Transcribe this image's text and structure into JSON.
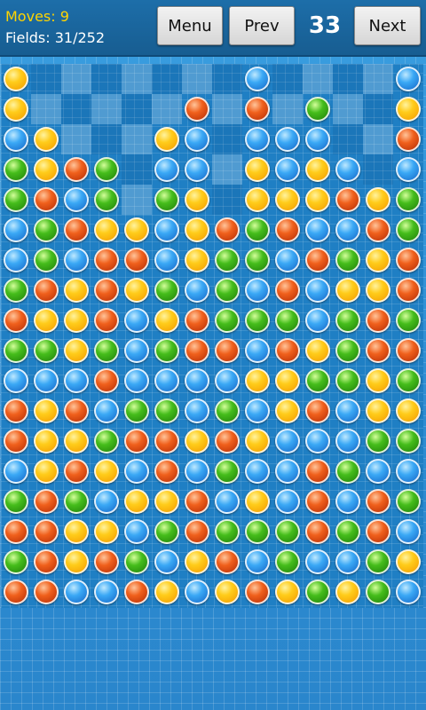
{
  "stats": {
    "moves": "Moves: 9",
    "fields": "Fields: 31/252"
  },
  "toolbar": {
    "menu_label": "Menu",
    "prev_label": "Prev",
    "level": "33",
    "next_label": "Next"
  },
  "colors": {
    "O": "orange",
    "B": "blue",
    "G": "green",
    "R": "red"
  },
  "board": {
    "columns": 14,
    "rows": 18,
    "cleared_cells": 31,
    "balls": [
      [
        "O",
        "",
        "",
        "",
        "",
        "",
        "",
        "",
        "B",
        "",
        "",
        "",
        "",
        "B"
      ],
      [
        "O",
        "",
        "",
        "",
        "",
        "",
        "R",
        "",
        "R",
        "",
        "G",
        "",
        "",
        "O"
      ],
      [
        "B",
        "O",
        "",
        "",
        "",
        "O",
        "B",
        "",
        "B",
        "B",
        "B",
        "",
        "",
        "R"
      ],
      [
        "G",
        "O",
        "R",
        "G",
        "",
        "B",
        "B",
        "",
        "O",
        "B",
        "O",
        "B",
        "",
        "B"
      ],
      [
        "G",
        "R",
        "B",
        "G",
        "",
        "G",
        "O",
        "",
        "O",
        "O",
        "O",
        "R",
        "O",
        "G"
      ],
      [
        "B",
        "G",
        "R",
        "O",
        "O",
        "B",
        "O",
        "R",
        "G",
        "R",
        "B",
        "B",
        "R",
        "G"
      ],
      [
        "B",
        "G",
        "B",
        "R",
        "R",
        "B",
        "O",
        "G",
        "G",
        "B",
        "R",
        "G",
        "O",
        "R"
      ],
      [
        "G",
        "R",
        "O",
        "R",
        "O",
        "G",
        "B",
        "G",
        "B",
        "R",
        "B",
        "O",
        "O",
        "R"
      ],
      [
        "R",
        "O",
        "O",
        "R",
        "B",
        "O",
        "R",
        "G",
        "G",
        "G",
        "B",
        "G",
        "R",
        "G"
      ],
      [
        "G",
        "G",
        "O",
        "G",
        "B",
        "G",
        "R",
        "R",
        "B",
        "R",
        "O",
        "G",
        "R",
        "R"
      ],
      [
        "B",
        "B",
        "B",
        "R",
        "B",
        "B",
        "B",
        "B",
        "O",
        "O",
        "G",
        "G",
        "O",
        "G"
      ],
      [
        "R",
        "O",
        "R",
        "B",
        "G",
        "G",
        "B",
        "G",
        "B",
        "O",
        "R",
        "B",
        "O",
        "O"
      ],
      [
        "R",
        "O",
        "O",
        "G",
        "R",
        "R",
        "O",
        "R",
        "O",
        "B",
        "B",
        "B",
        "G",
        "G"
      ],
      [
        "B",
        "O",
        "R",
        "O",
        "B",
        "R",
        "B",
        "G",
        "B",
        "B",
        "R",
        "G",
        "B",
        "B"
      ],
      [
        "G",
        "R",
        "G",
        "B",
        "O",
        "O",
        "R",
        "B",
        "O",
        "B",
        "R",
        "B",
        "R",
        "G"
      ],
      [
        "R",
        "R",
        "O",
        "O",
        "B",
        "G",
        "R",
        "G",
        "G",
        "G",
        "R",
        "G",
        "R",
        "B"
      ],
      [
        "G",
        "R",
        "O",
        "R",
        "G",
        "B",
        "O",
        "R",
        "B",
        "G",
        "B",
        "B",
        "G",
        "O"
      ],
      [
        "R",
        "R",
        "B",
        "B",
        "R",
        "O",
        "B",
        "O",
        "R",
        "O",
        "G",
        "O",
        "G",
        "B"
      ]
    ]
  }
}
